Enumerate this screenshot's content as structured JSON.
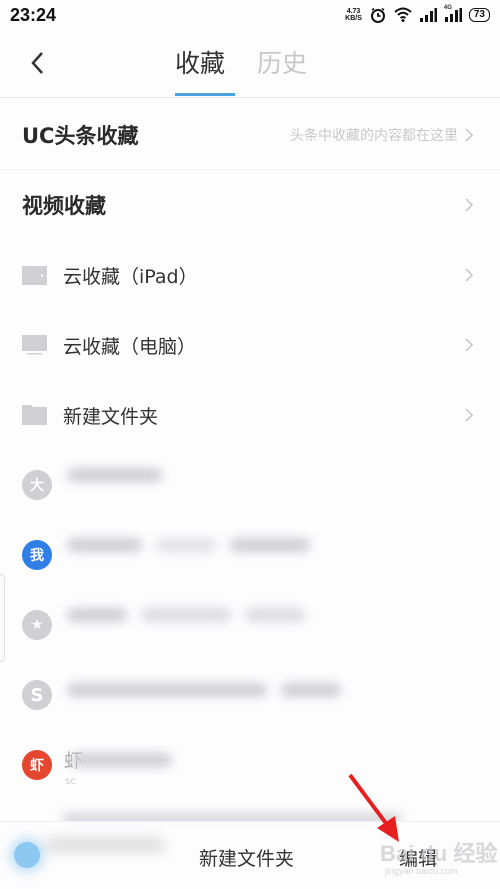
{
  "status_bar": {
    "time": "23:24",
    "net_speed_value": "4.73",
    "net_speed_unit": "KB/S",
    "network_label": "4G",
    "battery": "73"
  },
  "nav": {
    "back_icon": "chevron-left-icon",
    "tabs": [
      {
        "label": "收藏",
        "active": true
      },
      {
        "label": "历史",
        "active": false
      }
    ],
    "accent_color": "#4aa3df"
  },
  "sections": {
    "uc_headlines": {
      "title": "UC头条收藏",
      "subtitle": "头条中收藏的内容都在这里"
    },
    "video": {
      "title": "视频收藏"
    }
  },
  "folders": [
    {
      "icon": "tablet-icon",
      "label": "云收藏（iPad）"
    },
    {
      "icon": "monitor-icon",
      "label": "云收藏（电脑）"
    },
    {
      "icon": "folder-icon",
      "label": "新建文件夹"
    }
  ],
  "bookmarks": [
    {
      "avatar_text": "大",
      "avatar_color": "#cfcfd4"
    },
    {
      "avatar_text": "我",
      "avatar_color": "#2f7fe6"
    },
    {
      "avatar_text": "★",
      "avatar_color": "#cfcfd4"
    },
    {
      "avatar_text": "S",
      "avatar_color": "#cfcfd4"
    },
    {
      "avatar_text": "虾",
      "avatar_color": "#e5462f",
      "title_start": "虾",
      "subtitle_start": "sc"
    }
  ],
  "bottom_bar": {
    "new_folder_label": "新建文件夹",
    "edit_label": "编辑"
  },
  "watermark": {
    "text": "Bai du 经验",
    "sub": "jingyan.baidu.com"
  }
}
